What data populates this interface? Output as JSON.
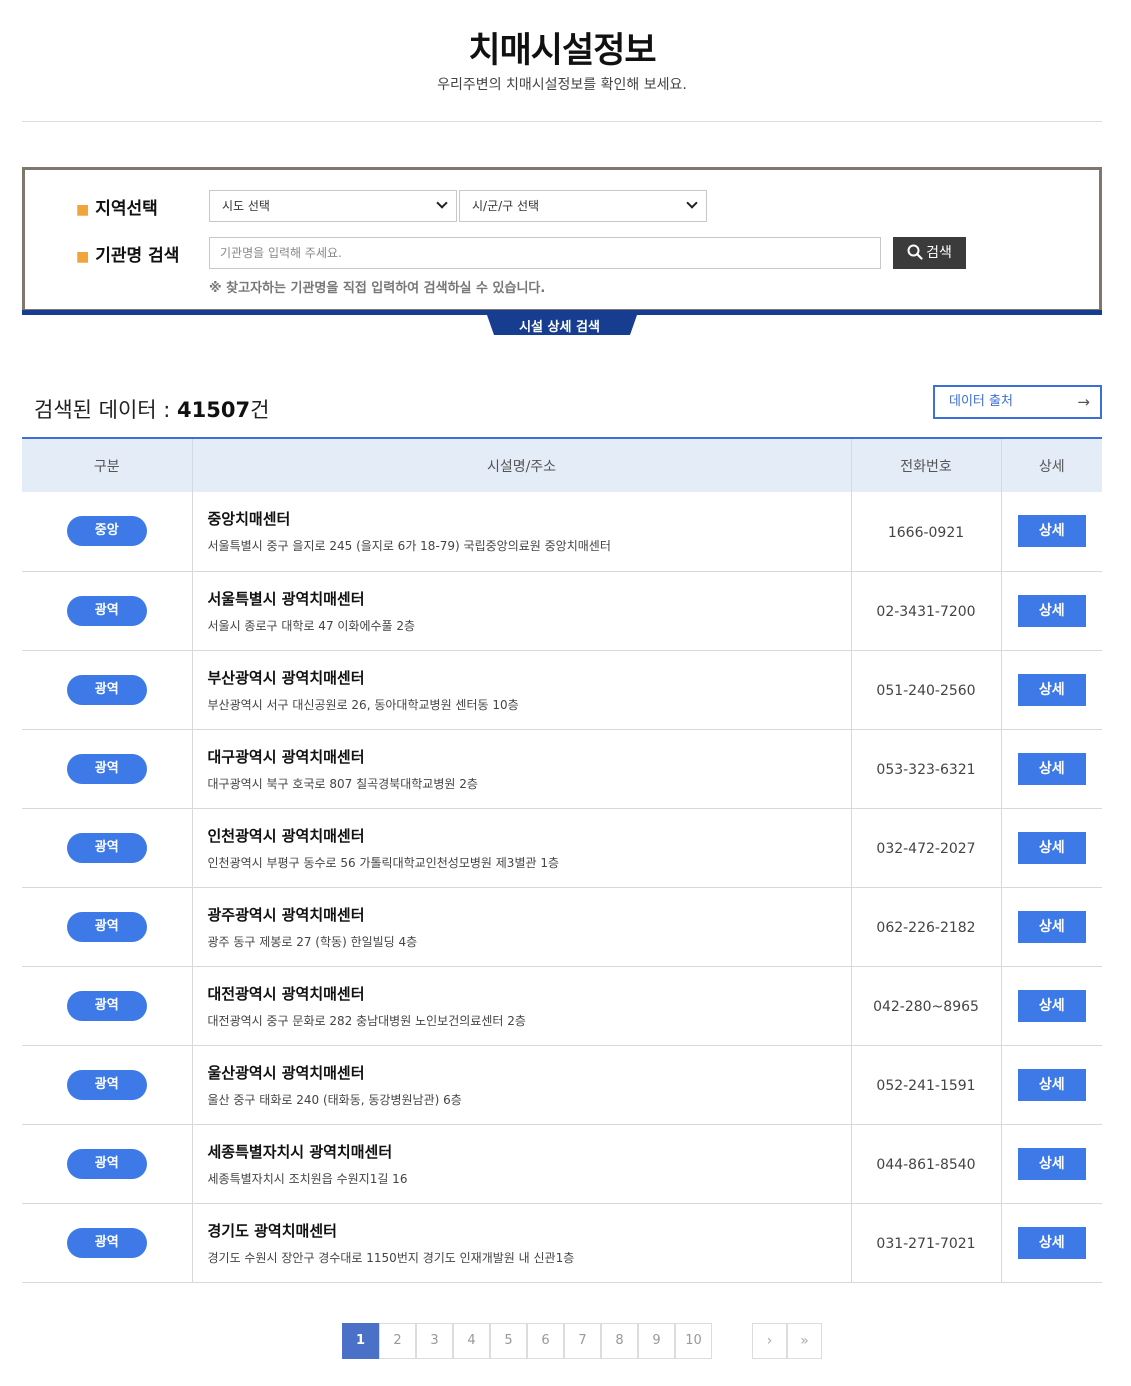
{
  "header": {
    "title": "치매시설정보",
    "subtitle": "우리주변의 치매시설정보를 확인해 보세요."
  },
  "search": {
    "region_label": "지역선택",
    "sido_selected": "시도 선택",
    "sigungu_selected": "시/군/구 선택",
    "name_label": "기관명 검색",
    "name_placeholder": "기관명을 입력해 주세요.",
    "search_button": "검색",
    "hint": "※ 찾고자하는 기관명을 직접 입력하여 검색하실 수 있습니다.",
    "detail_tab": "시설 상세 검색"
  },
  "result": {
    "count_label": "검색된 데이터 : ",
    "count_value": "41507",
    "count_unit": "건",
    "source_button": "데이터 출처"
  },
  "table": {
    "headers": [
      "구분",
      "시설명/주소",
      "전화번호",
      "상세"
    ],
    "rows": [
      {
        "type": "중앙",
        "name": "중앙치매센터",
        "address": "서울특별시 중구 을지로 245 (을지로 6가 18-79) 국립중앙의료원 중앙치매센터",
        "tel": "1666-0921",
        "detail": "상세"
      },
      {
        "type": "광역",
        "name": "서울특별시 광역치매센터",
        "address": "서울시 종로구 대학로 47 이화에수풀 2층",
        "tel": "02-3431-7200",
        "detail": "상세"
      },
      {
        "type": "광역",
        "name": "부산광역시 광역치매센터",
        "address": "부산광역시 서구 대신공원로 26, 동아대학교병원 센터동 10층",
        "tel": "051-240-2560",
        "detail": "상세"
      },
      {
        "type": "광역",
        "name": "대구광역시 광역치매센터",
        "address": "대구광역시 북구 호국로 807 칠곡경북대학교병원 2층",
        "tel": "053-323-6321",
        "detail": "상세"
      },
      {
        "type": "광역",
        "name": "인천광역시 광역치매센터",
        "address": "인천광역시 부평구 동수로 56 가톨릭대학교인천성모병원 제3별관 1층",
        "tel": "032-472-2027",
        "detail": "상세"
      },
      {
        "type": "광역",
        "name": "광주광역시 광역치매센터",
        "address": "광주 동구 제봉로 27 (학동) 한일빌딩 4층",
        "tel": "062-226-2182",
        "detail": "상세"
      },
      {
        "type": "광역",
        "name": "대전광역시 광역치매센터",
        "address": "대전광역시 중구 문화로 282 충남대병원 노인보건의료센터 2층",
        "tel": "042-280~8965",
        "detail": "상세"
      },
      {
        "type": "광역",
        "name": "울산광역시 광역치매센터",
        "address": "울산 중구 태화로 240 (태화동, 동강병원남관) 6층",
        "tel": "052-241-1591",
        "detail": "상세"
      },
      {
        "type": "광역",
        "name": "세종특별자치시 광역치매센터",
        "address": "세종특별자치시 조치원읍 수원지1길 16",
        "tel": "044-861-8540",
        "detail": "상세"
      },
      {
        "type": "광역",
        "name": "경기도 광역치매센터",
        "address": "경기도 수원시 장안구 경수대로 1150번지 경기도 인재개발원 내 신관1층",
        "tel": "031-271-7021",
        "detail": "상세"
      }
    ]
  },
  "pagination": {
    "pages": [
      "1",
      "2",
      "3",
      "4",
      "5",
      "6",
      "7",
      "8",
      "9",
      "10"
    ],
    "current": "1",
    "next": "›",
    "last": "»"
  },
  "colors": {
    "accent": "#3d7ae8",
    "pager_active": "#4a70c8",
    "search_border": "#7d776e",
    "navy": "#163d8f"
  }
}
